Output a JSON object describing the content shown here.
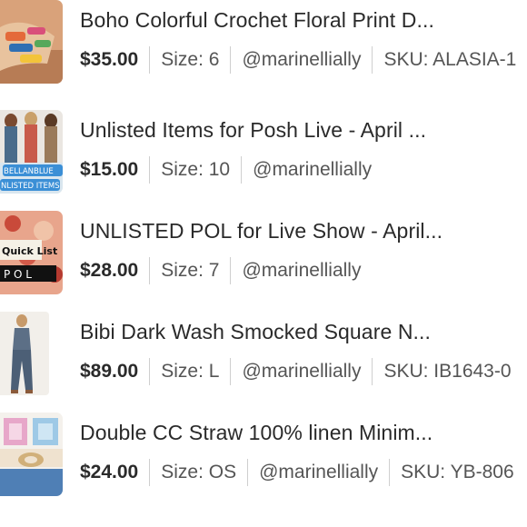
{
  "listings": [
    {
      "title": "Boho Colorful Crochet Floral Print D...",
      "price": "$35.00",
      "size": "Size: 6",
      "seller": "@marinellially",
      "sku": "SKU: ALASIA-1"
    },
    {
      "title": "Unlisted Items for Posh Live - April ...",
      "price": "$15.00",
      "size": "Size: 10",
      "seller": "@marinellially",
      "sku": "",
      "thumb_text": [
        "BELLANBLUE",
        "NLISTED ITEMS"
      ]
    },
    {
      "title": "UNLISTED POL for Live Show - April...",
      "price": "$28.00",
      "size": "Size: 7",
      "seller": "@marinellially",
      "sku": "",
      "thumb_text": [
        "Quick List",
        "P O L"
      ]
    },
    {
      "title": "Bibi Dark Wash Smocked Square N...",
      "price": "$89.00",
      "size": "Size: L",
      "seller": "@marinellially",
      "sku": "SKU: IB1643-0"
    },
    {
      "title": "Double CC Straw 100% linen Minim...",
      "price": "$24.00",
      "size": "Size: OS",
      "seller": "@marinellially",
      "sku": "SKU: YB-806"
    }
  ]
}
